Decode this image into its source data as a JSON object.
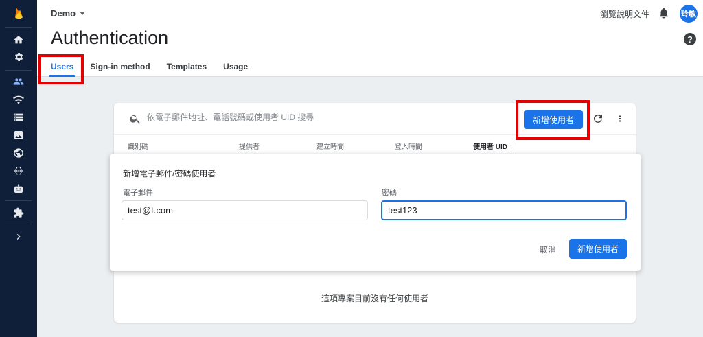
{
  "header": {
    "project": "Demo",
    "title": "Authentication",
    "docs_link": "瀏覽說明文件",
    "avatar_text": "玲敏"
  },
  "tabs": [
    {
      "label": "Users",
      "active": true
    },
    {
      "label": "Sign-in method",
      "active": false
    },
    {
      "label": "Templates",
      "active": false
    },
    {
      "label": "Usage",
      "active": false
    }
  ],
  "users": {
    "search_placeholder": "依電子郵件地址、電話號碼或使用者 UID 搜尋",
    "add_user_label": "新增使用者",
    "columns": [
      "識別碼",
      "提供者",
      "建立時間",
      "登入時間",
      "使用者 UID ↑"
    ],
    "empty_message": "這項專案目前沒有任何使用者"
  },
  "dialog": {
    "title": "新增電子郵件/密碼使用者",
    "email_label": "電子郵件",
    "email_value": "test@t.com",
    "password_label": "密碼",
    "password_value": "test123",
    "cancel_label": "取消",
    "submit_label": "新增使用者"
  },
  "colors": {
    "accent": "#1a73e8",
    "sidebar": "#0f1f3a",
    "highlight": "#e60000"
  },
  "sidebar_icons": [
    "firebase-logo-icon",
    "home-icon",
    "gear-icon",
    "users-icon",
    "realtime-db-icon",
    "storage-icon",
    "images-icon",
    "globe-icon",
    "functions-icon",
    "ml-robot-icon",
    "extensions-icon",
    "expand-chevron-icon"
  ]
}
